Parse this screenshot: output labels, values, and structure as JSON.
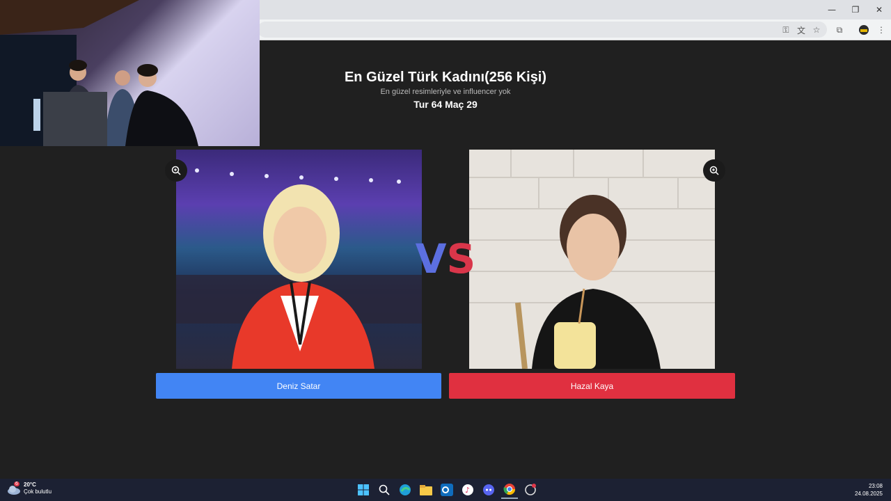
{
  "page": {
    "title": "En Güzel Türk Kadını(256 Kişi)",
    "subtitle": "En güzel resimleriyle ve influencer yok",
    "round": "Tur 64 Maç 29",
    "vs_v": "V",
    "vs_s": "S",
    "left_choice": "Deniz Satar",
    "right_choice": "Hazal Kaya",
    "zoom_icon": "zoom-in-icon"
  },
  "colors": {
    "left_button": "#4285f4",
    "right_button": "#e03040",
    "background": "#202020"
  },
  "taskbar": {
    "weather_badge": "6",
    "temperature": "20°C",
    "weather_desc": "Çok bulutlu",
    "time": "23:08",
    "date": "24.08.2025",
    "apps": [
      "windows-start",
      "search",
      "edge",
      "file-explorer",
      "outlook",
      "itunes",
      "discord",
      "chrome",
      "steelseries"
    ]
  }
}
